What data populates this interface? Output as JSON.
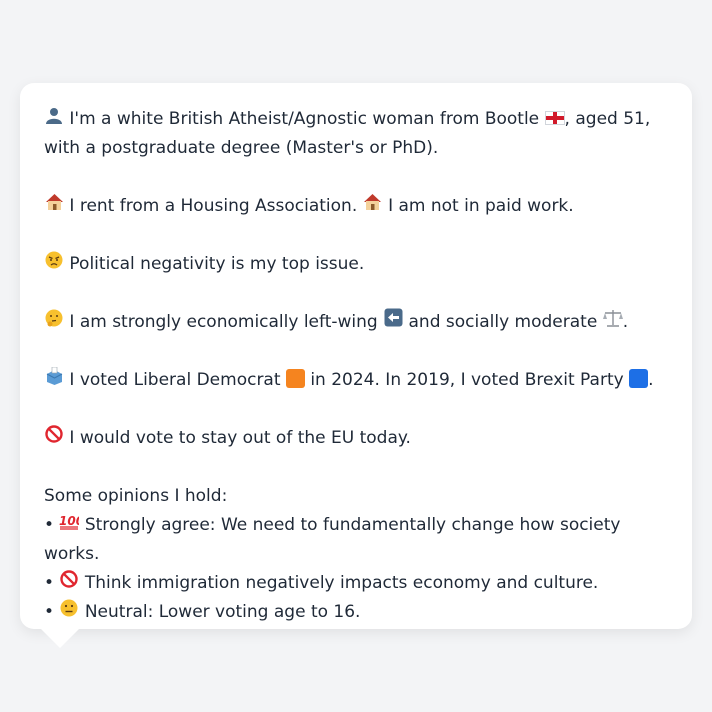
{
  "profile": {
    "p1": {
      "icon": "person-silhouette-icon",
      "text_a": "I'm a white British Atheist/Agnostic woman from Bootle",
      "flag": "england-flag-icon",
      "text_b": ", aged 51, with a postgraduate degree (Master's or PhD)."
    },
    "p2": {
      "icon1": "house-icon",
      "text_a": "I rent from a Housing Association.",
      "icon2": "house-icon",
      "text_b": "I am not in paid work."
    },
    "p3": {
      "icon": "angry-face-icon",
      "text": "Political negativity is my top issue."
    },
    "p4": {
      "icon": "thinking-face-icon",
      "text_a": "I am strongly economically left-wing",
      "icon2": "left-arrow-icon",
      "text_b": "and socially moderate",
      "icon3": "scales-icon",
      "text_c": "."
    },
    "p5": {
      "icon": "ballot-box-icon",
      "text_a": "I voted Liberal Democrat",
      "color_a": "#f5841f",
      "text_b": "in 2024. In 2019, I voted Brexit Party",
      "color_b": "#1d6fe6",
      "text_c": "."
    },
    "p6": {
      "icon": "prohibited-icon",
      "text": "I would vote to stay out of the EU today."
    },
    "opinions": {
      "heading": "Some opinions I hold:",
      "items": [
        {
          "bullet": "•",
          "icon": "hundred-points-icon",
          "text": "Strongly agree: We need to fundamentally change how society works."
        },
        {
          "bullet": "•",
          "icon": "prohibited-icon",
          "text": "Think immigration negatively impacts economy and culture."
        },
        {
          "bullet": "•",
          "icon": "neutral-face-icon",
          "text": "Neutral: Lower voting age to 16."
        }
      ]
    }
  }
}
